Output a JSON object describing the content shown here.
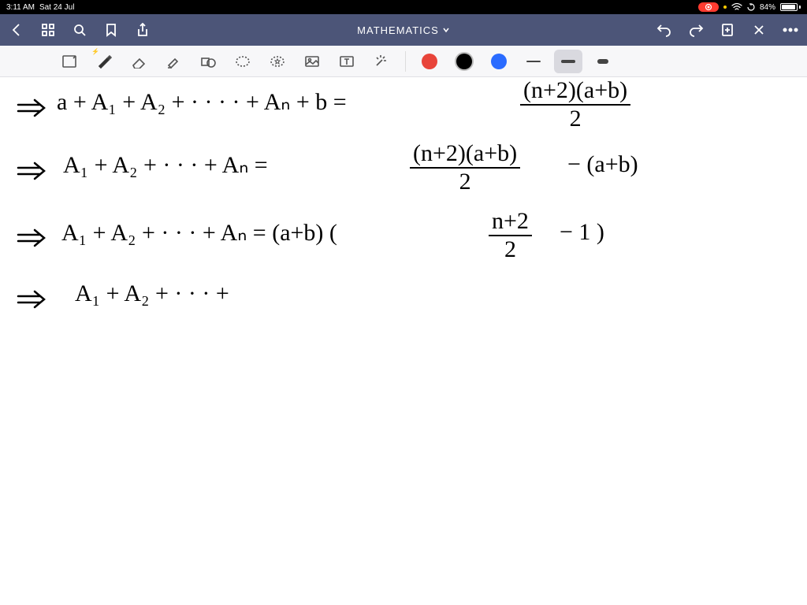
{
  "status": {
    "time": "3:11 AM",
    "date": "Sat 24 Jul",
    "battery_pct": "84%"
  },
  "header": {
    "title": "MATHEMATICS"
  },
  "tools": {
    "names": {
      "readmode": "read-mode-icon",
      "pen": "pen-icon",
      "eraser": "eraser-icon",
      "highlighter": "highlighter-icon",
      "shape": "shape-icon",
      "lasso": "lasso-icon",
      "favorites": "star-icon",
      "image": "image-icon",
      "text": "text-icon",
      "laser": "laser-icon"
    }
  },
  "lines": {
    "l1_left": "a + A₁ + A₂ + · · · · + Aₙ + b  =",
    "l1_frac_num": "(n+2)(a+b)",
    "l1_frac_den": "2",
    "l2_left": "A₁ + A₂ + · · · + Aₙ  =",
    "l2_frac_num": "(n+2)(a+b)",
    "l2_frac_den": "2",
    "l2_tail": " − (a+b)",
    "l3_left": "A₁ + A₂ + · · · + Aₙ  =  (a+b) (",
    "l3_frac_num": "n+2",
    "l3_frac_den": "2",
    "l3_tail": " − 1 )",
    "l4": "A₁ + A₂ + · · · +"
  }
}
